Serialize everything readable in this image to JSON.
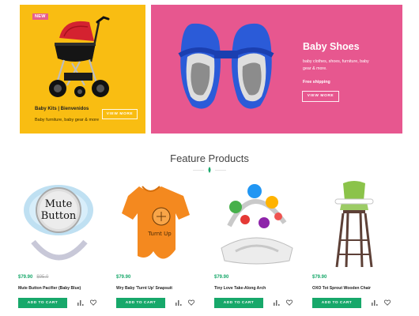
{
  "banner_left": {
    "badge": "NEW",
    "title": "Baby Kits | Bienvenidos",
    "subtitle": "Baby furniture, baby gear & more",
    "button": "VIEW MORE",
    "color": "#f9bd12"
  },
  "banner_right": {
    "title": "Baby Shoes",
    "text": "baby clothes, shoes, furniture, baby gear & more.",
    "shipping": "Free shipping",
    "button": "VIEW MORE",
    "color": "#e7578f"
  },
  "section": {
    "title": "Feature Products"
  },
  "products": [
    {
      "price": "$79.90",
      "old_price": "$95.0",
      "name": "Mute Button Pacifier (Baby Blue)",
      "cart_label": "ADD TO CART",
      "image_text_1": "Mute",
      "image_text_2": "Button"
    },
    {
      "price": "$79.90",
      "old_price": "",
      "name": "Wry Baby 'Turnt Up' Snapsuit",
      "cart_label": "ADD TO CART",
      "image_text": "Turnt Up"
    },
    {
      "price": "$79.90",
      "old_price": "",
      "name": "Tiny Love Take-Along Arch",
      "cart_label": "ADD TO CART"
    },
    {
      "price": "$79.90",
      "old_price": "",
      "name": "OXO Tot Sprout Wooden Chair",
      "cart_label": "ADD TO CART"
    }
  ],
  "colors": {
    "accent_green": "#17a86a",
    "pink": "#e7578f",
    "yellow": "#f9bd12"
  },
  "icons": {
    "compare": "bar-chart-icon",
    "wishlist": "heart-icon"
  }
}
